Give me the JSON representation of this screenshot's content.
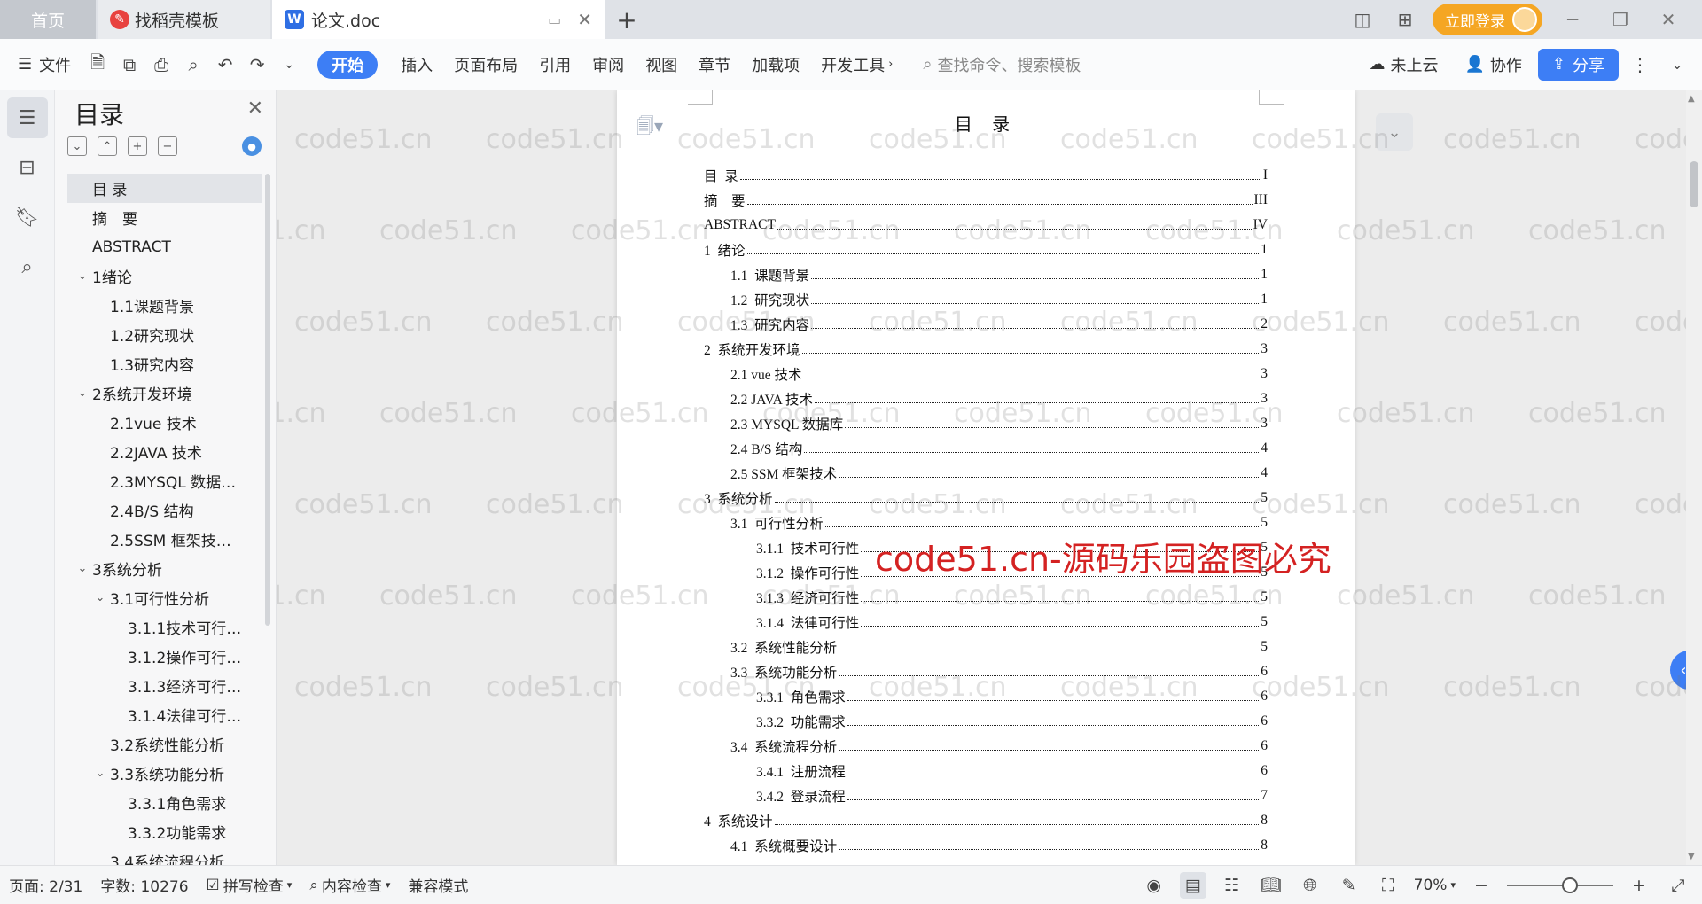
{
  "titlebar": {
    "tabs": [
      {
        "label": "首页"
      },
      {
        "label": "找稻壳模板"
      },
      {
        "label": "论文.doc"
      }
    ],
    "login_label": "立即登录"
  },
  "ribbon": {
    "menu_label": "文件",
    "tabs": [
      "开始",
      "插入",
      "页面布局",
      "引用",
      "审阅",
      "视图",
      "章节",
      "加载项",
      "开发工具"
    ],
    "search_placeholder": "查找命令、搜索模板",
    "cloud_label": "未上云",
    "collab_label": "协作",
    "share_label": "分享"
  },
  "outline": {
    "title": "目录",
    "items": [
      {
        "label": "目  录",
        "level": 0,
        "selected": true
      },
      {
        "label": "摘　要",
        "level": 0
      },
      {
        "label": "ABSTRACT",
        "level": 0
      },
      {
        "label": "1绪论",
        "level": 0,
        "expandable": true
      },
      {
        "label": "1.1课题背景",
        "level": 1
      },
      {
        "label": "1.2研究现状",
        "level": 1
      },
      {
        "label": "1.3研究内容",
        "level": 1
      },
      {
        "label": "2系统开发环境",
        "level": 0,
        "expandable": true
      },
      {
        "label": "2.1vue 技术",
        "level": 1
      },
      {
        "label": "2.2JAVA 技术",
        "level": 1
      },
      {
        "label": "2.3MYSQL 数据…",
        "level": 1
      },
      {
        "label": "2.4B/S 结构",
        "level": 1
      },
      {
        "label": "2.5SSM 框架技…",
        "level": 1
      },
      {
        "label": "3系统分析",
        "level": 0,
        "expandable": true
      },
      {
        "label": "3.1可行性分析",
        "level": 1,
        "expandable": true
      },
      {
        "label": "3.1.1技术可行…",
        "level": 2
      },
      {
        "label": "3.1.2操作可行…",
        "level": 2
      },
      {
        "label": "3.1.3经济可行…",
        "level": 2
      },
      {
        "label": "3.1.4法律可行…",
        "level": 2
      },
      {
        "label": "3.2系统性能分析",
        "level": 1
      },
      {
        "label": "3.3系统功能分析",
        "level": 1,
        "expandable": true
      },
      {
        "label": "3.3.1角色需求",
        "level": 2
      },
      {
        "label": "3.3.2功能需求",
        "level": 2
      },
      {
        "label": "3.4系统流程分析",
        "level": 1
      }
    ]
  },
  "document": {
    "heading": "目 录",
    "toc": [
      {
        "text": "目  录",
        "page": "I",
        "level": 1
      },
      {
        "text": "摘　要",
        "page": "III",
        "level": 1
      },
      {
        "text": "ABSTRACT",
        "page": "IV",
        "level": 1
      },
      {
        "text": "1  绪论",
        "page": "1",
        "level": 1
      },
      {
        "text": "1.1  课题背景",
        "page": "1",
        "level": 2
      },
      {
        "text": "1.2  研究现状",
        "page": "1",
        "level": 2
      },
      {
        "text": "1.3  研究内容",
        "page": "2",
        "level": 2
      },
      {
        "text": "2  系统开发环境",
        "page": "3",
        "level": 1
      },
      {
        "text": "2.1 vue 技术",
        "page": "3",
        "level": 2
      },
      {
        "text": "2.2 JAVA 技术",
        "page": "3",
        "level": 2
      },
      {
        "text": "2.3 MYSQL 数据库",
        "page": "3",
        "level": 2
      },
      {
        "text": "2.4 B/S 结构",
        "page": "4",
        "level": 2
      },
      {
        "text": "2.5 SSM 框架技术",
        "page": "4",
        "level": 2
      },
      {
        "text": "3  系统分析",
        "page": "5",
        "level": 1
      },
      {
        "text": "3.1  可行性分析",
        "page": "5",
        "level": 2
      },
      {
        "text": "3.1.1  技术可行性",
        "page": "5",
        "level": 3
      },
      {
        "text": "3.1.2  操作可行性",
        "page": "5",
        "level": 3
      },
      {
        "text": "3.1.3  经济可行性",
        "page": "5",
        "level": 3
      },
      {
        "text": "3.1.4  法律可行性",
        "page": "5",
        "level": 3
      },
      {
        "text": "3.2  系统性能分析",
        "page": "5",
        "level": 2
      },
      {
        "text": "3.3  系统功能分析",
        "page": "6",
        "level": 2
      },
      {
        "text": "3.3.1  角色需求",
        "page": "6",
        "level": 3
      },
      {
        "text": "3.3.2  功能需求",
        "page": "6",
        "level": 3
      },
      {
        "text": "3.4  系统流程分析",
        "page": "6",
        "level": 2
      },
      {
        "text": "3.4.1  注册流程",
        "page": "6",
        "level": 3
      },
      {
        "text": "3.4.2  登录流程",
        "page": "7",
        "level": 3
      },
      {
        "text": "4  系统设计",
        "page": "8",
        "level": 1
      },
      {
        "text": "4.1  系统概要设计",
        "page": "8",
        "level": 2
      }
    ]
  },
  "watermark": {
    "text": "code51.cn",
    "banner": "code51.cn-源码乐园盗图必究"
  },
  "statusbar": {
    "page": "页面: 2/31",
    "words": "字数: 10276",
    "spellcheck": "拼写检查",
    "content_check": "内容检查",
    "compat_mode": "兼容模式",
    "zoom": "70%"
  },
  "colors": {
    "accent": "#3d7ef5",
    "login": "#f5a623",
    "watermark_banner": "#d42222"
  }
}
